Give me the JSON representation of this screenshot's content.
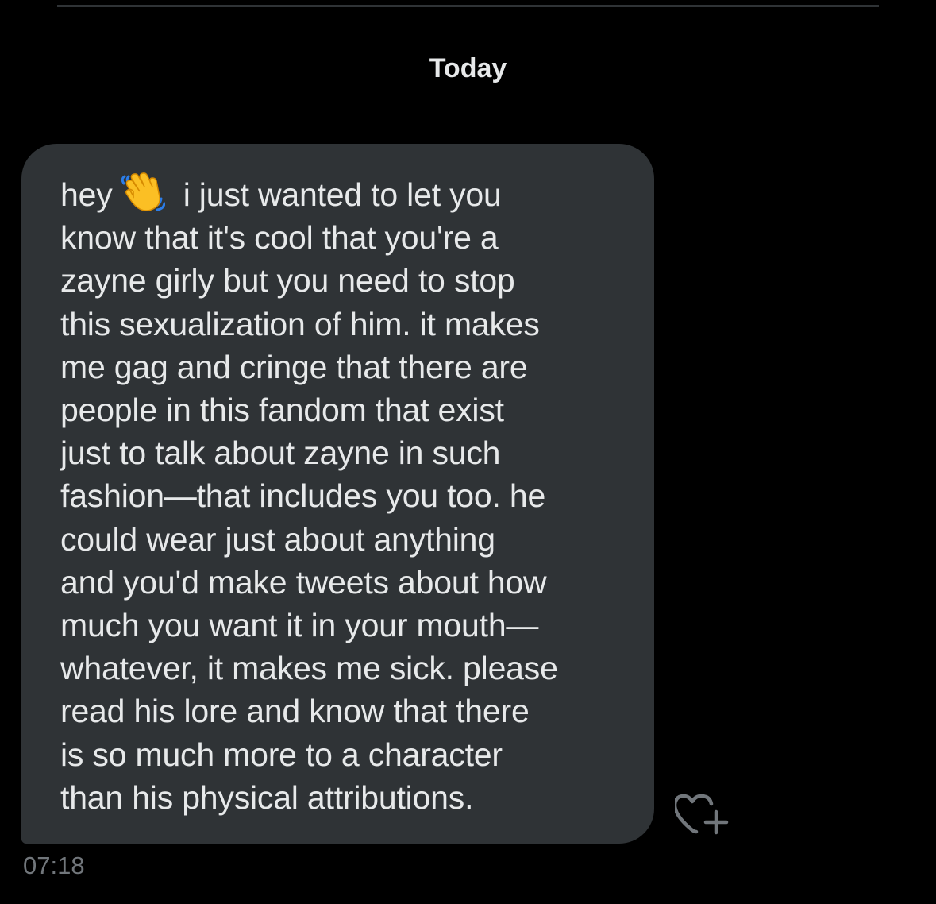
{
  "conversation": {
    "date_separator": "Today",
    "messages": [
      {
        "text_before_emoji": "hey",
        "emoji": "waving-hand-emoji",
        "lines": [
          " i just wanted to let you",
          "know that it's cool that you're a",
          "zayne girly but you need to stop",
          "this sexualization of him. it makes",
          "me gag and cringe that there are",
          "people in this fandom that exist",
          "just to talk about zayne in such",
          "fashion—that includes you too. he",
          "could wear just about anything",
          "and you'd make tweets about how",
          "much you want it in your mouth—",
          "whatever, it makes me sick. please",
          "read his lore and know that there",
          "is so much more to a character",
          "than his physical attributions."
        ],
        "timestamp": "07:18",
        "react_icon": "heart-plus-icon"
      }
    ]
  },
  "colors": {
    "background": "#000000",
    "bubble": "#2f3336",
    "text": "#e7e9ea",
    "muted": "#71767b"
  }
}
